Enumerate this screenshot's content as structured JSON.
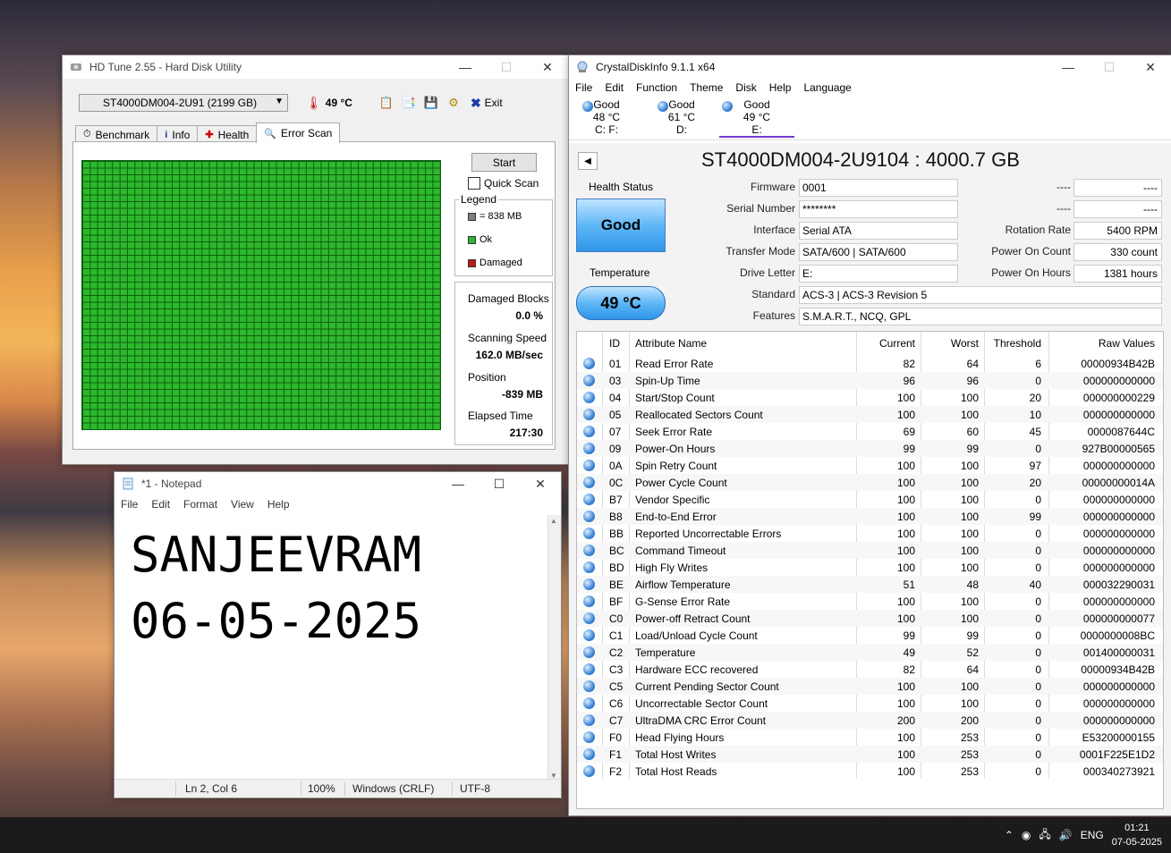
{
  "hdtune": {
    "title": "HD Tune 2.55 - Hard Disk Utility",
    "drive_select": "ST4000DM004-2U91 (2199 GB)",
    "temperature": "49 °C",
    "exit_label": "Exit",
    "tabs": [
      {
        "label": "Benchmark",
        "icon": "stopwatch-icon"
      },
      {
        "label": "Info",
        "icon": "info-icon"
      },
      {
        "label": "Health",
        "icon": "health-cross-icon"
      },
      {
        "label": "Error Scan",
        "icon": "magnifier-icon"
      }
    ],
    "start_label": "Start",
    "quick_scan_label": "Quick Scan",
    "legend": {
      "title": "Legend",
      "block": "= 838 MB",
      "ok": "Ok",
      "damaged": "Damaged"
    },
    "stats": {
      "damaged_blocks_label": "Damaged Blocks",
      "damaged_blocks_value": "0.0 %",
      "scanning_speed_label": "Scanning Speed",
      "scanning_speed_value": "162.0 MB/sec",
      "position_label": "Position",
      "position_value": "-839 MB",
      "elapsed_label": "Elapsed Time",
      "elapsed_value": "217:30"
    },
    "colors": {
      "ok": "#2db82d",
      "damaged": "#c01818",
      "block": "#808080"
    }
  },
  "notepad": {
    "title": "*1 - Notepad",
    "menu": [
      "File",
      "Edit",
      "Format",
      "View",
      "Help"
    ],
    "content": "SANJEEVRAM\n06-05-2025",
    "status": {
      "position": "Ln 2, Col 6",
      "zoom": "100%",
      "line_ending": "Windows (CRLF)",
      "encoding": "UTF-8"
    }
  },
  "cdi": {
    "title": "CrystalDiskInfo 9.1.1 x64",
    "menu": [
      "File",
      "Edit",
      "Function",
      "Theme",
      "Disk",
      "Help",
      "Language"
    ],
    "drives": [
      {
        "status": "Good",
        "temp": "48 °C",
        "letter": "C: F:"
      },
      {
        "status": "Good",
        "temp": "61 °C",
        "letter": "D:"
      },
      {
        "status": "Good",
        "temp": "49 °C",
        "letter": "E:"
      }
    ],
    "model": "ST4000DM004-2U9104 : 4000.7 GB",
    "health_status_label": "Health Status",
    "health_status": "Good",
    "temperature_label": "Temperature",
    "temperature": "49 °C",
    "fields": {
      "firmware_label": "Firmware",
      "firmware": "0001",
      "serial_label": "Serial Number",
      "serial": "********",
      "interface_label": "Interface",
      "interface": "Serial ATA",
      "transfer_label": "Transfer Mode",
      "transfer": "SATA/600 | SATA/600",
      "drive_letter_label": "Drive Letter",
      "drive_letter": "E:",
      "standard_label": "Standard",
      "standard": "ACS-3 | ACS-3 Revision 5",
      "features_label": "Features",
      "features": "S.M.A.R.T., NCQ, GPL",
      "blank1_label": "----",
      "blank1": "----",
      "blank2_label": "----",
      "blank2": "----",
      "rotation_label": "Rotation Rate",
      "rotation": "5400 RPM",
      "power_count_label": "Power On Count",
      "power_count": "330 count",
      "power_hours_label": "Power On Hours",
      "power_hours": "1381 hours"
    },
    "columns": [
      "ID",
      "Attribute Name",
      "Current",
      "Worst",
      "Threshold",
      "Raw Values"
    ],
    "rows": [
      [
        "01",
        "Read Error Rate",
        "82",
        "64",
        "6",
        "00000934B42B"
      ],
      [
        "03",
        "Spin-Up Time",
        "96",
        "96",
        "0",
        "000000000000"
      ],
      [
        "04",
        "Start/Stop Count",
        "100",
        "100",
        "20",
        "000000000229"
      ],
      [
        "05",
        "Reallocated Sectors Count",
        "100",
        "100",
        "10",
        "000000000000"
      ],
      [
        "07",
        "Seek Error Rate",
        "69",
        "60",
        "45",
        "0000087644C"
      ],
      [
        "09",
        "Power-On Hours",
        "99",
        "99",
        "0",
        "927B00000565"
      ],
      [
        "0A",
        "Spin Retry Count",
        "100",
        "100",
        "97",
        "000000000000"
      ],
      [
        "0C",
        "Power Cycle Count",
        "100",
        "100",
        "20",
        "00000000014A"
      ],
      [
        "B7",
        "Vendor Specific",
        "100",
        "100",
        "0",
        "000000000000"
      ],
      [
        "B8",
        "End-to-End Error",
        "100",
        "100",
        "99",
        "000000000000"
      ],
      [
        "BB",
        "Reported Uncorrectable Errors",
        "100",
        "100",
        "0",
        "000000000000"
      ],
      [
        "BC",
        "Command Timeout",
        "100",
        "100",
        "0",
        "000000000000"
      ],
      [
        "BD",
        "High Fly Writes",
        "100",
        "100",
        "0",
        "000000000000"
      ],
      [
        "BE",
        "Airflow Temperature",
        "51",
        "48",
        "40",
        "000032290031"
      ],
      [
        "BF",
        "G-Sense Error Rate",
        "100",
        "100",
        "0",
        "000000000000"
      ],
      [
        "C0",
        "Power-off Retract Count",
        "100",
        "100",
        "0",
        "000000000077"
      ],
      [
        "C1",
        "Load/Unload Cycle Count",
        "99",
        "99",
        "0",
        "0000000008BC"
      ],
      [
        "C2",
        "Temperature",
        "49",
        "52",
        "0",
        "001400000031"
      ],
      [
        "C3",
        "Hardware ECC recovered",
        "82",
        "64",
        "0",
        "00000934B42B"
      ],
      [
        "C5",
        "Current Pending Sector Count",
        "100",
        "100",
        "0",
        "000000000000"
      ],
      [
        "C6",
        "Uncorrectable Sector Count",
        "100",
        "100",
        "0",
        "000000000000"
      ],
      [
        "C7",
        "UltraDMA CRC Error Count",
        "200",
        "200",
        "0",
        "000000000000"
      ],
      [
        "F0",
        "Head Flying Hours",
        "100",
        "253",
        "0",
        "E53200000155"
      ],
      [
        "F1",
        "Total Host Writes",
        "100",
        "253",
        "0",
        "0001F225E1D2"
      ],
      [
        "F2",
        "Total Host Reads",
        "100",
        "253",
        "0",
        "000340273921"
      ]
    ],
    "colors": {
      "good": "#2f95e9",
      "active_tab": "#6f3bd1"
    }
  },
  "taskbar": {
    "language": "ENG",
    "time": "01:21",
    "date": "07-05-2025"
  }
}
